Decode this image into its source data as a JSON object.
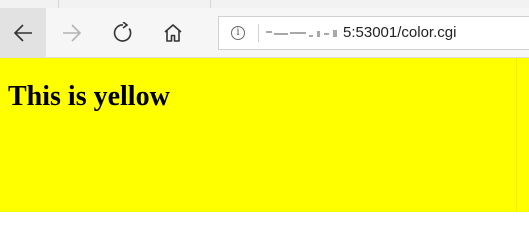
{
  "browser": {
    "address_bar": {
      "url_visible": "5:53001/color.cgi",
      "info_glyph": "i"
    },
    "icons": {
      "back": "arrow-left-icon",
      "forward": "arrow-right-icon",
      "refresh": "refresh-icon",
      "home": "home-icon",
      "info": "info-icon"
    }
  },
  "page": {
    "background_color": "#ffff00",
    "heading": "This is yellow"
  }
}
